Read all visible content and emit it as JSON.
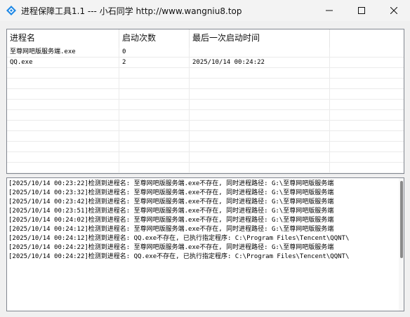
{
  "window": {
    "title": "进程保障工具1.1    --- 小石同学 http://www.wangniu8.top"
  },
  "listview": {
    "columns": [
      "进程名",
      "启动次数",
      "最后一次启动时间"
    ],
    "rows": [
      [
        "至尊网吧版服务端.exe",
        "0",
        ""
      ],
      [
        "QQ.exe",
        "2",
        "2025/10/14 00:24:22"
      ]
    ]
  },
  "log": {
    "lines": [
      "[2025/10/14 00:23:22]检测到进程名: 至尊网吧版服务端.exe不存在, 同时进程路径: G:\\至尊网吧版服务端",
      "[2025/10/14 00:23:32]检测到进程名: 至尊网吧版服务端.exe不存在, 同时进程路径: G:\\至尊网吧版服务端",
      "[2025/10/14 00:23:42]检测到进程名: 至尊网吧版服务端.exe不存在, 同时进程路径: G:\\至尊网吧版服务端",
      "[2025/10/14 00:23:51]检测到进程名: 至尊网吧版服务端.exe不存在, 同时进程路径: G:\\至尊网吧版服务端",
      "[2025/10/14 00:24:02]检测到进程名: 至尊网吧版服务端.exe不存在, 同时进程路径: G:\\至尊网吧版服务端",
      "[2025/10/14 00:24:12]检测到进程名: 至尊网吧版服务端.exe不存在, 同时进程路径: G:\\至尊网吧版服务端",
      "[2025/10/14 00:24:12]检测到进程名: QQ.exe不存在, 已执行指定程序: C:\\Program Files\\Tencent\\QQNT\\",
      "[2025/10/14 00:24:22]检测到进程名: 至尊网吧版服务端.exe不存在, 同时进程路径: G:\\至尊网吧版服务端",
      "[2025/10/14 00:24:22]检测到进程名: QQ.exe不存在, 已执行指定程序: C:\\Program Files\\Tencent\\QQNT\\"
    ]
  },
  "icons": {
    "app": "app-icon",
    "minimize": "minimize-icon",
    "maximize": "maximize-icon",
    "close": "close-icon"
  },
  "colors": {
    "accent": "#1e88e5",
    "window_bg": "#f0f0f0"
  }
}
